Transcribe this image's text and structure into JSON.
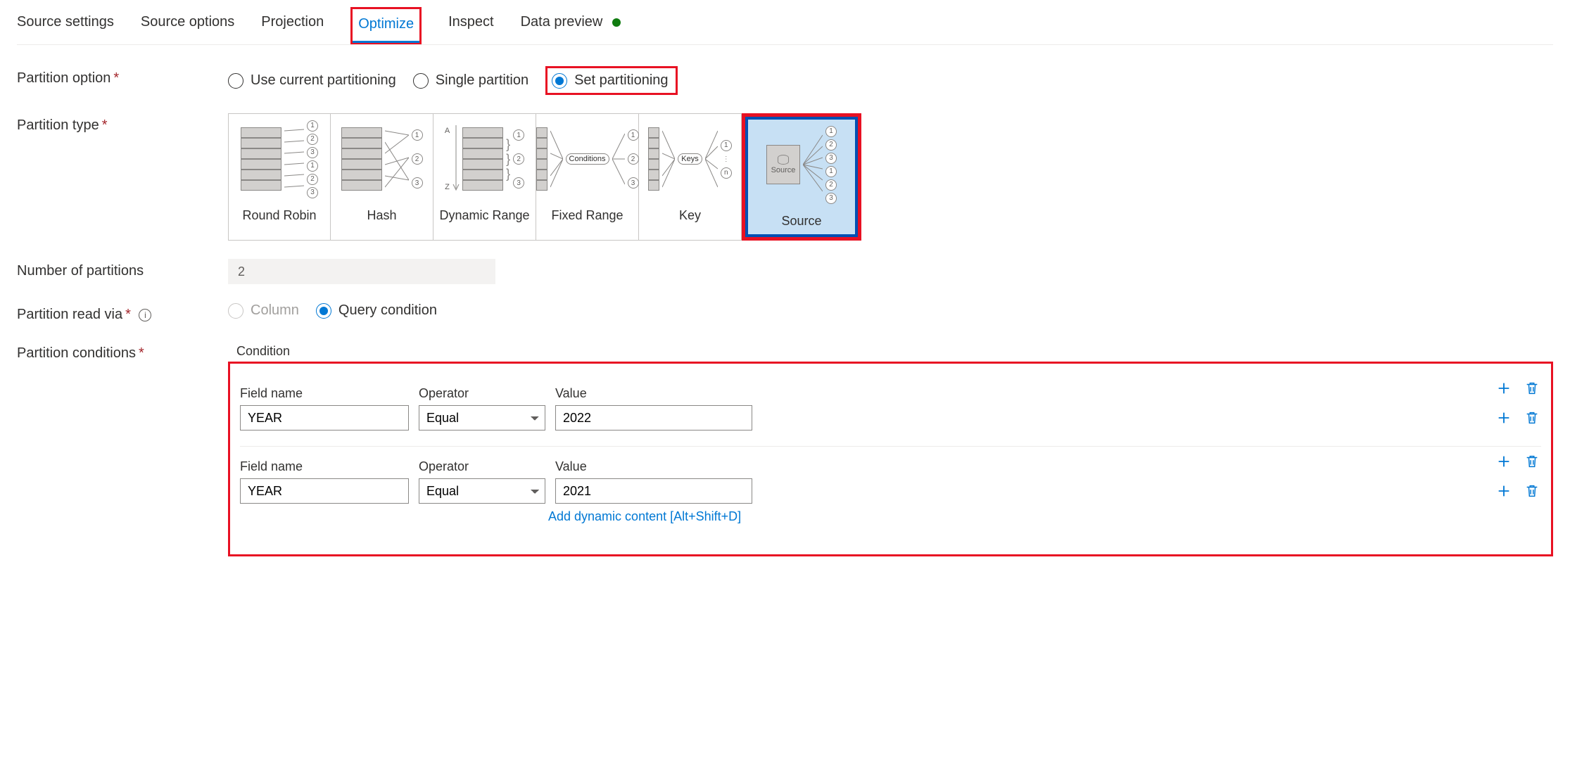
{
  "tabs": {
    "source_settings": "Source settings",
    "source_options": "Source options",
    "projection": "Projection",
    "optimize": "Optimize",
    "inspect": "Inspect",
    "data_preview": "Data preview"
  },
  "labels": {
    "partition_option": "Partition option",
    "partition_type": "Partition type",
    "number_of_partitions": "Number of partitions",
    "partition_read_via": "Partition read via",
    "partition_conditions": "Partition conditions",
    "condition": "Condition",
    "field_name": "Field name",
    "operator": "Operator",
    "value": "Value"
  },
  "partition_option": {
    "use_current": "Use current partitioning",
    "single": "Single partition",
    "set": "Set partitioning",
    "selected": "set"
  },
  "partition_types": {
    "round_robin": "Round Robin",
    "hash": "Hash",
    "dynamic_range": "Dynamic Range",
    "fixed_range": "Fixed Range",
    "key": "Key",
    "source": "Source",
    "diag": {
      "conditions": "Conditions",
      "keys": "Keys",
      "source_label": "Source",
      "a": "A",
      "z": "Z",
      "n": "n"
    },
    "selected": "source"
  },
  "number_of_partitions": "2",
  "partition_read_via": {
    "column": "Column",
    "query": "Query condition",
    "selected": "query"
  },
  "conditions": [
    {
      "rows": [
        {
          "field": "YEAR",
          "operator": "Equal",
          "value": "2022"
        }
      ]
    },
    {
      "rows": [
        {
          "field": "YEAR",
          "operator": "Equal",
          "value": "2021"
        }
      ]
    }
  ],
  "dynamic_link": "Add dynamic content [Alt+Shift+D]"
}
